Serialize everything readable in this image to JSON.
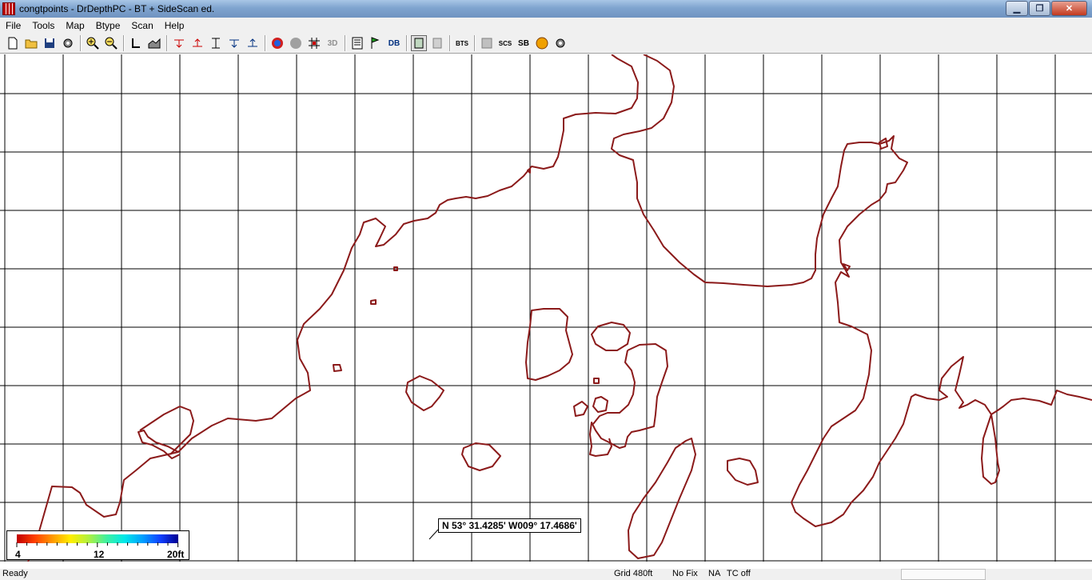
{
  "window": {
    "title": "congtpoints - DrDepthPC - BT + SideScan ed."
  },
  "menu": [
    "File",
    "Tools",
    "Map",
    "Btype",
    "Scan",
    "Help"
  ],
  "toolbar": {
    "labels": {
      "three_d": "3D",
      "bts": "BTS",
      "scs": "SCS",
      "sb": "SB",
      "db": "DB"
    }
  },
  "map": {
    "coordinate_readout": "N 53° 31.4285' W009° 17.4686'"
  },
  "legend": {
    "min_label": "4",
    "mid_label": "12",
    "max_label": "20ft",
    "colors": [
      "#c00000",
      "#ff4000",
      "#ff9a00",
      "#ffee00",
      "#b0f040",
      "#40f0a0",
      "#00e8e8",
      "#00a0ff",
      "#1040ff",
      "#000090"
    ]
  },
  "status": {
    "state": "Ready",
    "grid": "Grid 480ft",
    "fix": "No Fix",
    "na": "NA",
    "tc": "TC off"
  },
  "colors": {
    "shoreline": "#8b1a1a",
    "grid": "#000000"
  }
}
